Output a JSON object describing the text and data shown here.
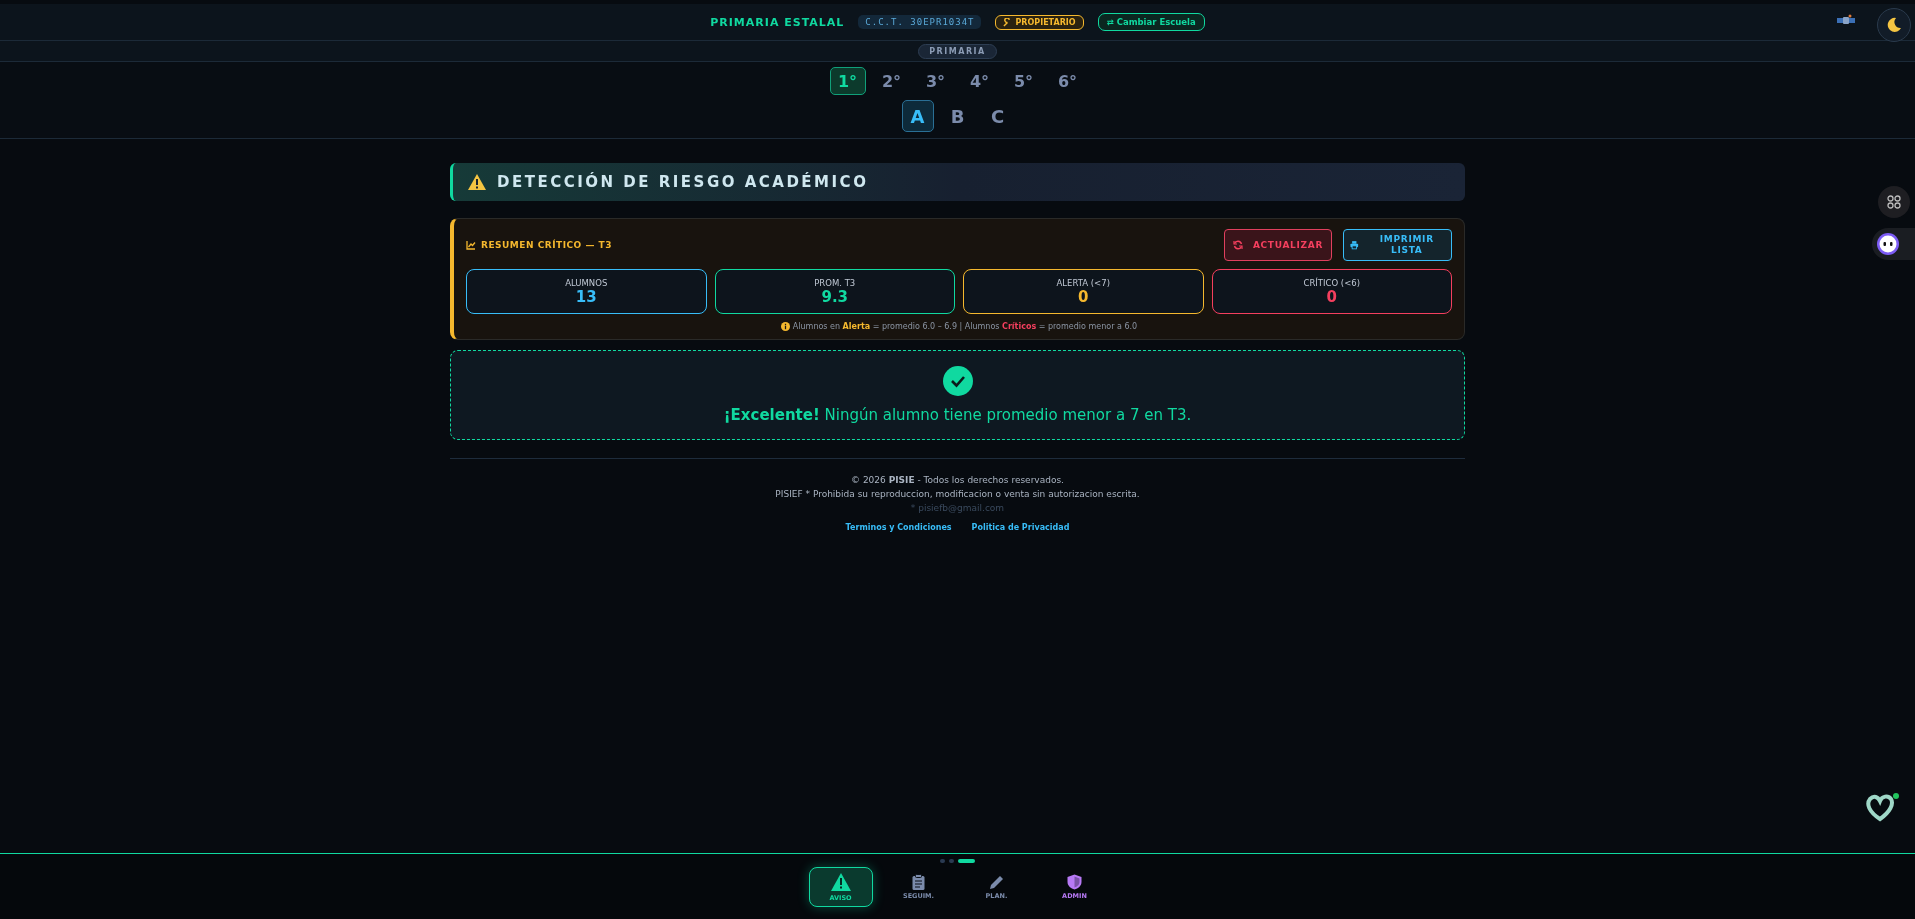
{
  "header": {
    "school": "PRIMARIA ESTALAL",
    "cct": "C.C.T. 30EPR1034T",
    "role": "PROPIETARIO",
    "switch_button": "⇄ Cambiar Escuela"
  },
  "level_badge": "PRIMARIA",
  "grades": [
    {
      "label": "1°",
      "selected": true
    },
    {
      "label": "2°",
      "selected": false
    },
    {
      "label": "3°",
      "selected": false
    },
    {
      "label": "4°",
      "selected": false
    },
    {
      "label": "5°",
      "selected": false
    },
    {
      "label": "6°",
      "selected": false
    }
  ],
  "groups": [
    {
      "label": "A",
      "selected": true
    },
    {
      "label": "B",
      "selected": false
    },
    {
      "label": "C",
      "selected": false
    }
  ],
  "page_title": "DETECCIÓN DE RIESGO ACADÉMICO",
  "summary": {
    "title": "RESUMEN CRÍTICO — T3",
    "refresh_button": "ACTUALIZAR",
    "print_button": "IMPRIMIR LISTA",
    "stats": [
      {
        "label": "ALUMNOS",
        "value": "13",
        "color": "#38bdf8"
      },
      {
        "label": "PROM. T3",
        "value": "9.3",
        "color": "#10d9a0"
      },
      {
        "label": "ALERTA (<7)",
        "value": "0",
        "color": "#f5b82e"
      },
      {
        "label": "CRÍTICO (<6)",
        "value": "0",
        "color": "#f43f5e"
      }
    ],
    "legend": [
      {
        "text": "Alumnos en "
      },
      {
        "text": "Alerta",
        "color": "#f5b82e"
      },
      {
        "text": " = promedio 6.0 – 6.9  |  Alumnos "
      },
      {
        "text": "Críticos",
        "color": "#f43f5e"
      },
      {
        "text": " = promedio menor a 6.0"
      }
    ]
  },
  "success_message": "**¡Excelente!** Ningún alumno tiene promedio menor a 7 en T3.",
  "footer": {
    "copyright": "© 2026 **PISIE** - Todos los derechos reservados.",
    "notice": "PISIEF * Prohibida su reproduccion, modificacion o venta sin autorizacion escrita.",
    "email": "* pisiefb@gmail.com",
    "links": [
      "Terminos y Condiciones",
      "Politica de Privacidad"
    ]
  },
  "pager_dots": [
    {
      "selected": false
    },
    {
      "selected": false
    },
    {
      "selected": true
    }
  ],
  "bottom_nav": [
    {
      "kind": "warning",
      "label": "AVISO",
      "selected": true,
      "color": "#10d9a0"
    },
    {
      "kind": "clipboard",
      "label": "SEGUIM.",
      "selected": false,
      "color": "#7b8bab"
    },
    {
      "kind": "pencil",
      "label": "PLAN.",
      "selected": false,
      "color": "#7b8bab"
    },
    {
      "kind": "shield",
      "label": "ADMIN",
      "selected": false,
      "color": "#b779f5"
    }
  ]
}
